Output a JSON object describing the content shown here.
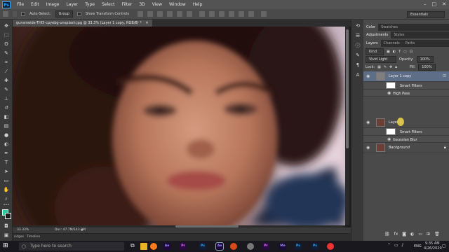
{
  "app": {
    "logo": "Ps"
  },
  "menubar": {
    "items": [
      "File",
      "Edit",
      "Image",
      "Layer",
      "Type",
      "Select",
      "Filter",
      "3D",
      "View",
      "Window",
      "Help"
    ],
    "window_controls": [
      "–",
      "□",
      "✕"
    ]
  },
  "options": {
    "auto_select_label": "Auto-Select:",
    "auto_select_value": "Group",
    "transform_label": "Show Transform Controls",
    "workspace": "Essentials"
  },
  "document": {
    "tab_title": "gunsmeide-THl5-cpyebg-unsplash.jpg @ 33.3% (Layer 1 copy, RGB/8) *",
    "zoom": "33.33%",
    "doc_info": "Doc: 47.7M/143.0M"
  },
  "timeline": {
    "label": "Timeline",
    "side": "ridges"
  },
  "panels": {
    "top_tabs": [
      "Color",
      "Swatches"
    ],
    "mid_tabs": [
      "Adjustments",
      "Styles"
    ],
    "layer_tabs": [
      "Layers",
      "Channels",
      "Paths"
    ],
    "kind_label": "Kind",
    "blend_mode": "Vivid Light",
    "opacity_label": "Opacity:",
    "opacity_value": "100%",
    "lock_label": "Lock:",
    "fill_label": "Fill:",
    "fill_value": "100%",
    "layers": [
      {
        "name": "Layer 1 copy",
        "filters_label": "Smart Filters",
        "filter": "High Pass"
      },
      {
        "name": "Layer 1",
        "filters_label": "Smart Filters",
        "filter": "Gaussian Blur"
      },
      {
        "name": "Background"
      }
    ]
  },
  "taskbar": {
    "search_placeholder": "Type here to search",
    "apps": [
      {
        "label": "Ae",
        "color": "#1f0740",
        "text": "#9999ff"
      },
      {
        "label": "Pr",
        "color": "#2a0a40",
        "text": "#ea77ff"
      },
      {
        "label": "Ps",
        "color": "#0e1e36",
        "text": "#31a8ff"
      },
      {
        "label": "Ae",
        "color": "#1f0740",
        "text": "#9999ff"
      },
      {
        "label": "Pr",
        "color": "#2a0a40",
        "text": "#ea77ff"
      },
      {
        "label": "Me",
        "color": "#1a0a36",
        "text": "#a090ff"
      },
      {
        "label": "Ps",
        "color": "#0e1e36",
        "text": "#31a8ff"
      },
      {
        "label": "Ps",
        "color": "#0e1e36",
        "text": "#31a8ff"
      }
    ],
    "language": "ENG",
    "time": "9:35 AM",
    "date": "4/26/2020"
  },
  "colors": {
    "foreground": "#2fc99c",
    "background": "#1a1a1a",
    "accent": "#31a8ff"
  }
}
